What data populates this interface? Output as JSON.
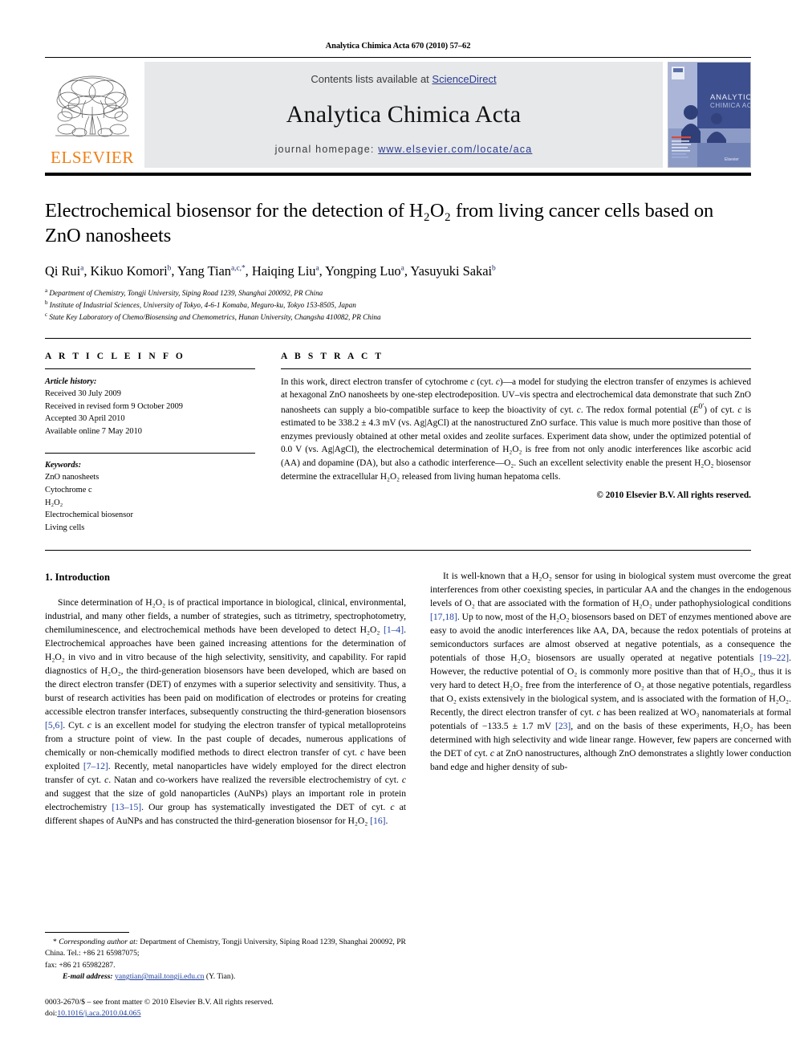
{
  "running_head": "Analytica Chimica Acta 670 (2010) 57–62",
  "masthead": {
    "publisher_name": "ELSEVIER",
    "contents_prefix": "Contents lists available at ",
    "contents_link": "ScienceDirect",
    "journal_title": "Analytica Chimica Acta",
    "homepage_prefix": "journal homepage: ",
    "homepage_url": "www.elsevier.com/locate/aca",
    "cover_title_line1": "ANALYTICA",
    "cover_title_line2": "CHIMICA ACTA"
  },
  "article": {
    "title": "Electrochemical biosensor for the detection of H₂O₂ from living cancer cells based on ZnO nanosheets",
    "authors_html": "Qi Rui<sup>a</sup>, Kikuo Komori<sup>b</sup>, Yang Tian<sup>a,c,</sup><sup>*</sup>, Haiqing Liu<sup>a</sup>, Yongping Luo<sup>a</sup>, Yasuyuki Sakai<sup>b</sup>",
    "affiliations": [
      "Department of Chemistry, Tongji University, Siping Road 1239, Shanghai 200092, PR China",
      "Institute of Industrial Sciences, University of Tokyo, 4-6-1 Komaba, Meguro-ku, Tokyo 153-8505, Japan",
      "State Key Laboratory of Chemo/Biosensing and Chemometrics, Hunan University, Changsha 410082, PR China"
    ],
    "affiliation_marks": [
      "a",
      "b",
      "c"
    ]
  },
  "article_info": {
    "heading": "A R T I C L E    I N F O",
    "history_label": "Article history:",
    "history": [
      "Received 30 July 2009",
      "Received in revised form 9 October 2009",
      "Accepted 30 April 2010",
      "Available online 7 May 2010"
    ],
    "keywords_label": "Keywords:",
    "keywords": [
      "ZnO nanosheets",
      "Cytochrome c",
      "H₂O₂",
      "Electrochemical biosensor",
      "Living cells"
    ]
  },
  "abstract": {
    "heading": "A B S T R A C T",
    "text_html": "In this work, direct electron transfer of cytochrome <i>c</i> (cyt. <i>c</i>)—a model for studying the electron transfer of enzymes is achieved at hexagonal ZnO nanosheets by one-step electrodeposition. UV–vis spectra and electrochemical data demonstrate that such ZnO nanosheets can supply a bio-compatible surface to keep the bioactivity of cyt. <i>c</i>. The redox formal potential (<i>E</i><sup>0′</sup>) of cyt. <i>c</i> is estimated to be 338.2 ± 4.3 mV (vs. Ag|AgCl) at the nanostructured ZnO surface. This value is much more positive than those of enzymes previously obtained at other metal oxides and zeolite surfaces. Experiment data show, under the optimized potential of 0.0 V (vs. Ag|AgCl), the electrochemical determination of H₂O₂ is free from not only anodic interferences like ascorbic acid (AA) and dopamine (DA), but also a cathodic interference—O₂. Such an excellent selectivity enable the present H₂O₂ biosensor determine the extracellular H₂O₂ released from living human hepatoma cells.",
    "copyright": "© 2010 Elsevier B.V. All rights reserved."
  },
  "introduction": {
    "heading": "1.  Introduction",
    "left_paragraph_1_html": "Since determination of H₂O₂ is of practical importance in biological, clinical, environmental, industrial, and many other fields, a number of strategies, such as titrimetry, spectrophotometry, chemiluminescence, and electrochemical methods have been developed to detect H₂O₂ <span class=\"ref\">[1–4]</span>. Electrochemical approaches have been gained increasing attentions for the determination of H₂O₂ in vivo and in vitro because of the high selectivity, sensitivity, and capability. For rapid diagnostics of H₂O₂, the third-generation biosensors have been developed, which are based on the direct electron transfer (DET) of enzymes with a superior selectivity and sensitivity. Thus, a burst of research activities has been paid on modification of electrodes or proteins for creating accessible electron transfer interfaces, subsequently constructing the third-generation biosensors <span class=\"ref\">[5,6]</span>. Cyt. <i>c</i> is an excellent model for studying the electron transfer of typical metalloproteins from a structure point of view. In the past couple of decades, numerous applications of chemically or non-chemically modified methods to direct electron transfer of cyt. <i>c</i> have been exploited <span class=\"ref\">[7–12]</span>. Recently, metal nanoparticles have widely employed for the direct electron transfer of cyt. <i>c</i>. Natan and co-workers have realized the reversible electrochemistry of cyt. <i>c</i> and suggest that the size of gold nanoparticles (AuNPs) plays an important role in protein electrochemistry <span class=\"ref\">[13–15]</span>. Our group has systematically investigated the DET of cyt. <i>c</i> at different shapes of AuNPs and has constructed the third-generation biosensor for H₂O₂ <span class=\"ref\">[16]</span>.",
    "right_paragraph_2_html": "It is well-known that a H₂O₂ sensor for using in biological system must overcome the great interferences from other coexisting species, in particular AA and the changes in the endogenous levels of O₂ that are associated with the formation of H₂O₂ under pathophysiological conditions <span class=\"ref\">[17,18]</span>. Up to now, most of the H₂O₂ biosensors based on DET of enzymes mentioned above are easy to avoid the anodic interferences like AA, DA, because the redox potentials of proteins at semiconductors surfaces are almost observed at negative potentials, as a consequence the potentials of those H₂O₂ biosensors are usually operated at negative potentials <span class=\"ref\">[19–22]</span>. However, the reductive potential of O₂ is commonly more positive than that of H₂O₂, thus it is very hard to detect H₂O₂ free from the interference of O₂ at those negative potentials, regardless that O₂ exists extensively in the biological system, and is associated with the formation of H₂O₂. Recently, the direct electron transfer of cyt. <i>c</i> has been realized at WO₃ nanomaterials at formal potentials of −133.5 ± 1.7 mV <span class=\"ref\">[23]</span>, and on the basis of these experiments, H₂O₂ has been determined with high selectivity and wide linear range. However, few papers are concerned with the DET of cyt. <i>c</i> at ZnO nanostructures, although ZnO demonstrates a slightly lower conduction band edge and higher density of sub-"
  },
  "footnotes": {
    "corresponding_html": "* <i>Corresponding author at:</i> Department of Chemistry, Tongji University, Siping Road 1239, Shanghai 200092, PR China. Tel.: +86 21 65987075;",
    "corresponding_line2": "fax: +86 21 65982287.",
    "email_label": "E-mail address:",
    "email": "yangtian@mail.tongji.edu.cn",
    "email_suffix": "(Y. Tian).",
    "imprint_line1": "0003-2670/$ – see front matter © 2010 Elsevier B.V. All rights reserved.",
    "imprint_doi_label": "doi:",
    "imprint_doi": "10.1016/j.aca.2010.04.065"
  },
  "colors": {
    "elsevier_orange": "#f07e13",
    "link_blue": "#2a3b8f",
    "ref_blue": "#1f3f9e",
    "masthead_grey": "#e7e8ea",
    "cover_blue": "#3d4f8f"
  }
}
